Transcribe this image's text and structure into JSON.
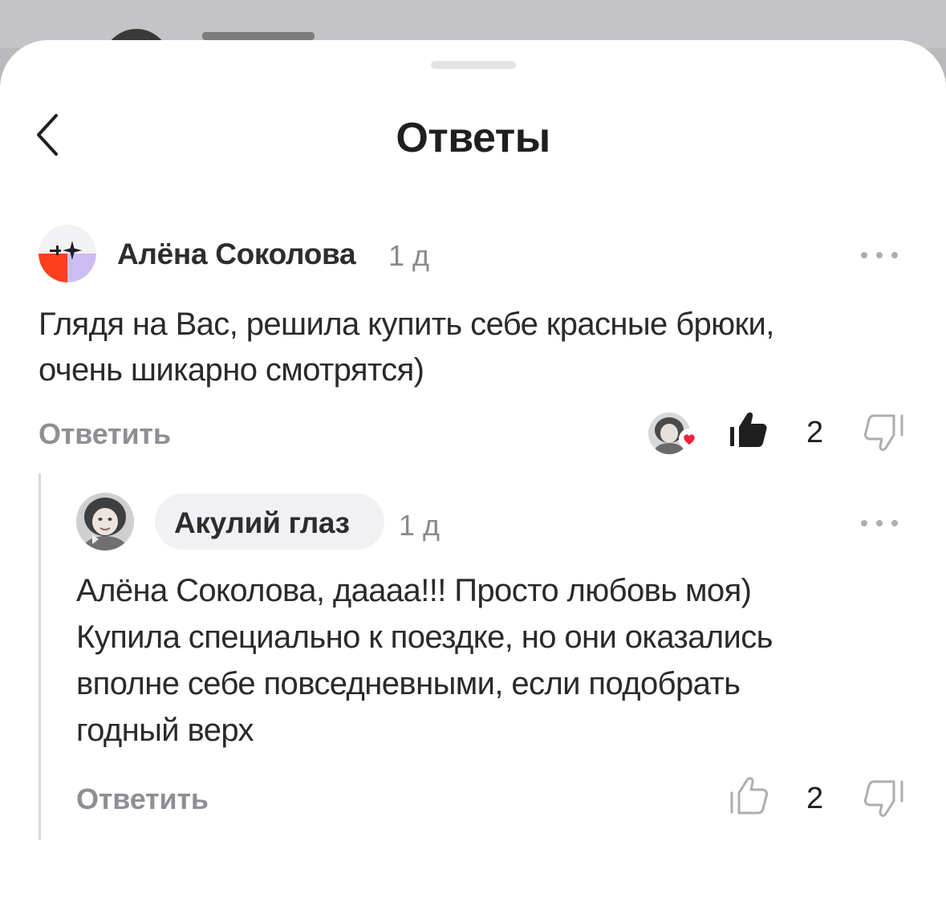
{
  "sheet": {
    "title": "Ответы"
  },
  "icons": {
    "back": "chevron-left-icon",
    "more": "more-horizontal-icon",
    "like": "thumbs-up-icon",
    "dislike": "thumbs-down-icon",
    "reaction": "heart-icon"
  },
  "colors": {
    "accent_orange": "#fc3f1d",
    "accent_lilac": "#cdbcf3",
    "like_filled": "#1f1f21",
    "reaction_heart": "#f0213a",
    "secondary_text": "#8e8e93"
  },
  "comments": [
    {
      "author": "Алёна Соколова",
      "time": "1 д",
      "text_lines": [
        "Глядя на Вас, решила купить себе красные брюки,",
        "очень шикарно смотрятся)"
      ],
      "reply_label": "Ответить",
      "likes": "2",
      "liked_by_me": true
    },
    {
      "author": "Акулий глаз",
      "time": "1 д",
      "text_lines": [
        "Алёна Соколова, даааа!!! Просто любовь моя)",
        "Купила специально к поездке, но они оказались",
        "вполне себе повседневными, если подобрать",
        "годный верх"
      ],
      "reply_label": "Ответить",
      "likes": "2",
      "liked_by_me": false
    }
  ]
}
